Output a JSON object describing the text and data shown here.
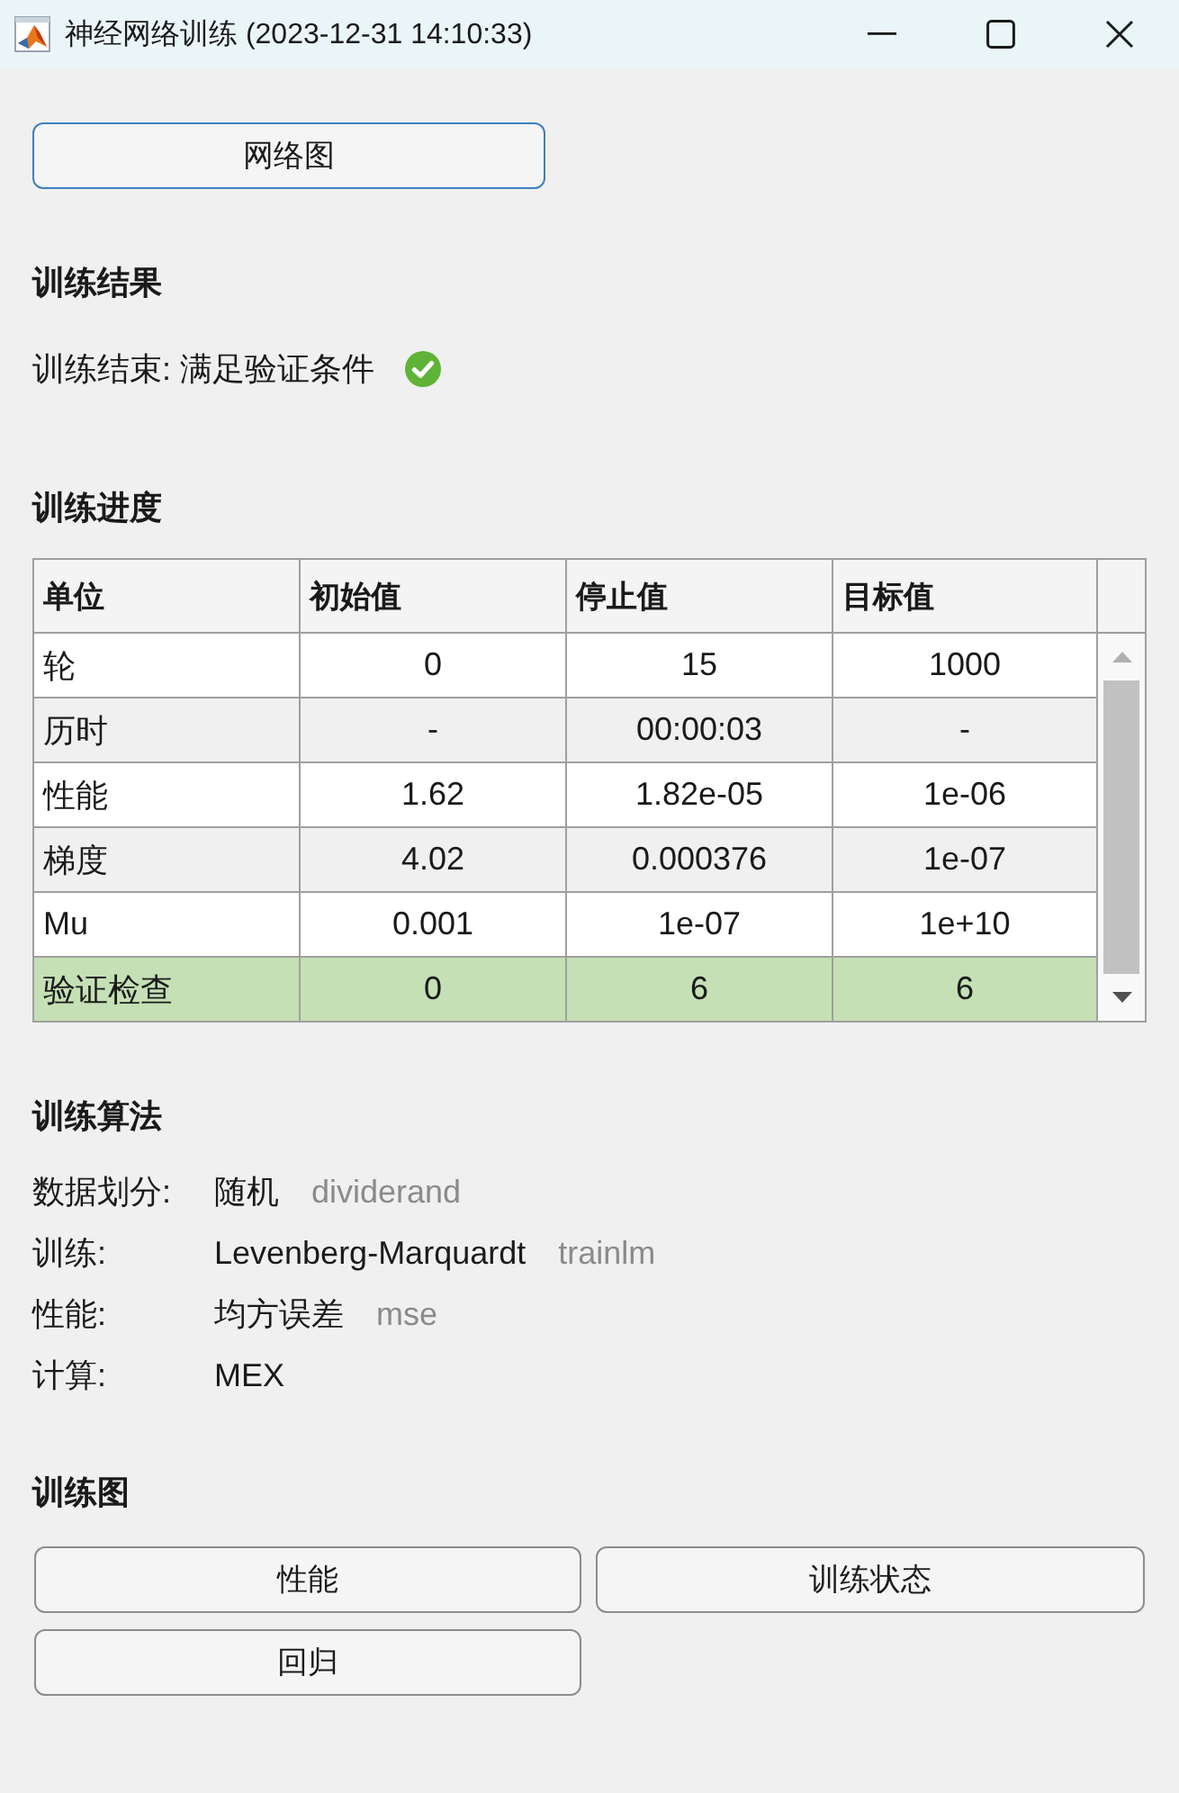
{
  "window": {
    "title": "神经网络训练 (2023-12-31 14:10:33)"
  },
  "network_button": {
    "label": "网络图",
    "focused": true
  },
  "result": {
    "heading": "训练结果",
    "message": "训练结束: 满足验证条件",
    "passed": true
  },
  "progress": {
    "heading": "训练进度",
    "columns": [
      "单位",
      "初始值",
      "停止值",
      "目标值"
    ],
    "rows": [
      {
        "cells": [
          "轮",
          "0",
          "15",
          "1000"
        ],
        "highlighted": false
      },
      {
        "cells": [
          "历时",
          "-",
          "00:00:03",
          "-"
        ],
        "highlighted": false
      },
      {
        "cells": [
          "性能",
          "1.62",
          "1.82e-05",
          "1e-06"
        ],
        "highlighted": false
      },
      {
        "cells": [
          "梯度",
          "4.02",
          "0.000376",
          "1e-07"
        ],
        "highlighted": false
      },
      {
        "cells": [
          "Mu",
          "0.001",
          "1e-07",
          "1e+10"
        ],
        "highlighted": false
      },
      {
        "cells": [
          "验证检查",
          "0",
          "6",
          "6"
        ],
        "highlighted": true
      }
    ]
  },
  "algorithms": {
    "heading": "训练算法",
    "items": [
      {
        "label": "数据划分:",
        "value": "随机",
        "function": "dividerand"
      },
      {
        "label": "训练:",
        "value": "Levenberg-Marquardt",
        "function": "trainlm"
      },
      {
        "label": "性能:",
        "value": "均方误差",
        "function": "mse"
      },
      {
        "label": "计算:",
        "value": "MEX"
      }
    ]
  },
  "plots": {
    "heading": "训练图",
    "buttons": [
      {
        "label": "性能",
        "focused": false
      },
      {
        "label": "训练状态",
        "focused": false
      },
      {
        "label": "回归",
        "focused": false
      }
    ]
  }
}
